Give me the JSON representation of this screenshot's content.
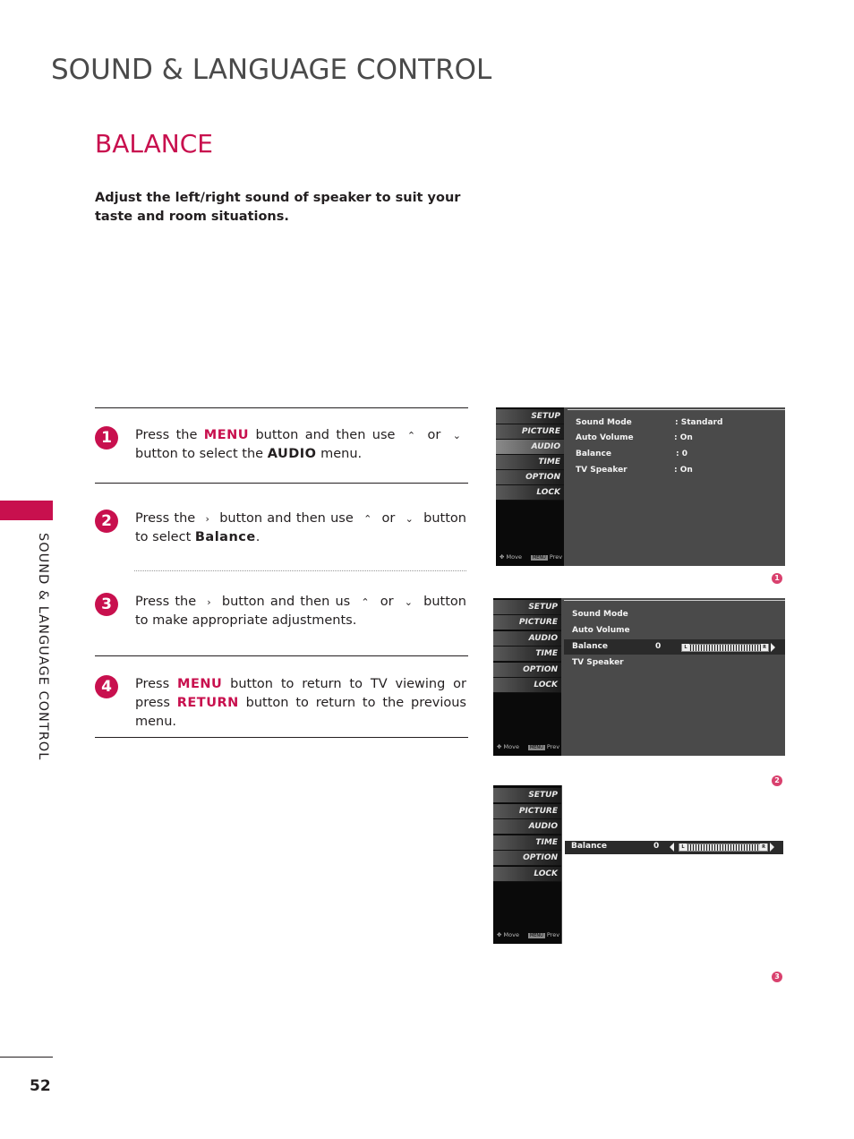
{
  "header": {
    "section_title": "SOUND & LANGUAGE CONTROL"
  },
  "page": {
    "heading": "BALANCE",
    "intro": "Adjust the left/right sound of speaker to suit your taste and room situations.",
    "side_label": "SOUND & LANGUAGE CONTROL",
    "page_number": "52",
    "accent_color": "#c8104e"
  },
  "steps": [
    {
      "num": "1",
      "parts": [
        "Press the ",
        "MENU",
        " button and then use ",
        "^",
        " or ",
        "v",
        " button to select the ",
        "AUDIO",
        " menu."
      ]
    },
    {
      "num": "2",
      "parts": [
        "Press the ",
        ">",
        " button and then use ",
        "^",
        " or ",
        "v",
        " button to select ",
        "Balance",
        "."
      ]
    },
    {
      "num": "3",
      "parts": [
        "Press the ",
        ">",
        " button and then us ",
        "^",
        " or ",
        "v",
        " button to make appropriate adjustments."
      ]
    },
    {
      "num": "4",
      "parts": [
        "Press ",
        "MENU",
        " button to return to TV viewing or press ",
        "RETURN",
        " button to return to the previous menu."
      ]
    }
  ],
  "glyphs": {
    "up": "⌃",
    "down": "⌄",
    "right": "›"
  },
  "osd": {
    "menu_items": [
      "SETUP",
      "PICTURE",
      "AUDIO",
      "TIME",
      "OPTION",
      "LOCK"
    ],
    "footer_move": "Move",
    "footer_menu": "MENU",
    "footer_prev": "Prev",
    "screen1": {
      "rows": [
        {
          "label": "Sound Mode",
          "value": ": Standard"
        },
        {
          "label": "Auto Volume",
          "value": ": On"
        },
        {
          "label": "Balance",
          "value": ": 0"
        },
        {
          "label": "TV Speaker",
          "value": ": On"
        }
      ],
      "fig_number": "1"
    },
    "screen2": {
      "rows": [
        {
          "label": "Sound Mode"
        },
        {
          "label": "Auto Volume"
        },
        {
          "label": "Balance",
          "value": "0"
        },
        {
          "label": "TV Speaker"
        }
      ],
      "bar_left": "L",
      "bar_right": "R",
      "fig_number": "2"
    },
    "screen3": {
      "label": "Balance",
      "value": "0",
      "bar_left": "L",
      "bar_right": "R",
      "fig_number": "3"
    }
  }
}
